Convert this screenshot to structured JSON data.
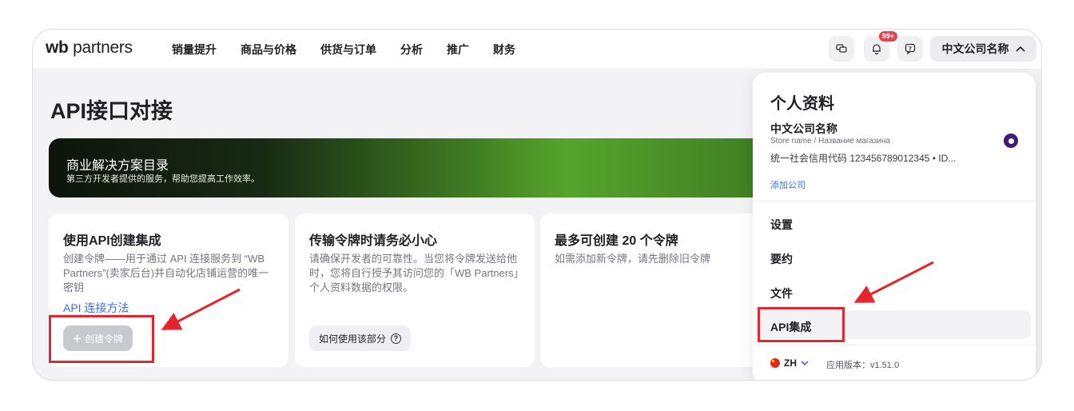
{
  "header": {
    "logo_prefix": "wb",
    "logo_word": "partners",
    "nav": [
      "销量提升",
      "商品与价格",
      "供货与订单",
      "分析",
      "推广",
      "财务"
    ],
    "notification_badge": "99+",
    "company_button": "中文公司名称"
  },
  "page": {
    "title": "API接口对接",
    "banner": {
      "title": "商业解决方案目录",
      "subtitle": "第三方开发者提供的服务，帮助您提高工作效率。"
    },
    "cards": [
      {
        "title": "使用API创建集成",
        "text": "创建令牌——用于通过 API 连接服务到 “WB Partners”(卖家后台)并自动化店铺运营的唯一密钥",
        "link": "API 连接方法",
        "button": "创建令牌"
      },
      {
        "title": "传输令牌时请务必小心",
        "text": "请确保开发者的可靠性。当您将令牌发送给他时，您将自行授予其访问您的「WB Partners」个人资料数据的权限。",
        "button": "如何使用该部分"
      },
      {
        "title": "最多可创建 20 个令牌",
        "text": "如需添加新令牌，请先删除旧令牌"
      }
    ]
  },
  "dropdown": {
    "heading": "个人资料",
    "company_name": "中文公司名称",
    "store_name": "Store name / Название магазина",
    "credit_code": "统一社会信用代码 123456789012345 • ID...",
    "add_company": "添加公司",
    "items": [
      "设置",
      "要约",
      "文件",
      "API集成"
    ],
    "language": "ZH",
    "version": "应用版本：v1.51.0"
  },
  "colors": {
    "accent_link": "#3b6fe0",
    "annotation_red": "#e3262d",
    "radio_selected": "#3d1d78"
  },
  "icons": [
    "chat-icon",
    "bell-icon",
    "help-chat-icon",
    "chevron-up-icon",
    "plus-icon",
    "question-icon",
    "china-flag-icon",
    "chevron-down-icon"
  ]
}
